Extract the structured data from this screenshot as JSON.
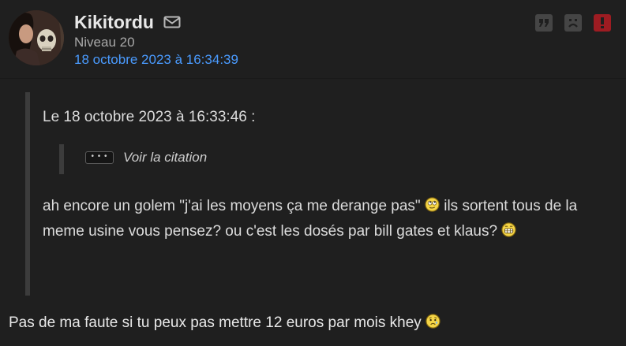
{
  "author": {
    "name": "Kikitordu",
    "level": "Niveau 20",
    "date": "18 octobre 2023 à 16:34:39"
  },
  "icons": {
    "mail": "envelope-icon",
    "quote": "quote-icon",
    "kick": "sad-face-icon",
    "alert": "exclamation-icon"
  },
  "colors": {
    "background": "#1f1f1f",
    "date_link": "#4a9bff",
    "alert": "#9d1c22",
    "quote_bar": "#3c3c3c"
  },
  "quote": {
    "header": "Le 18 octobre 2023 à 16:33:46 :",
    "expand_label": "• • •",
    "see_quote": "Voir la citation",
    "text_part1": "ah encore un golem \"j'ai les moyens ça me derange pas\"",
    "text_part2": "ils sortent tous de la meme usine vous pensez? ou c'est les dosés par bill gates et klaus?"
  },
  "reply": {
    "text": "Pas de ma faute si tu peux pas mettre 12 euros par mois khey"
  }
}
